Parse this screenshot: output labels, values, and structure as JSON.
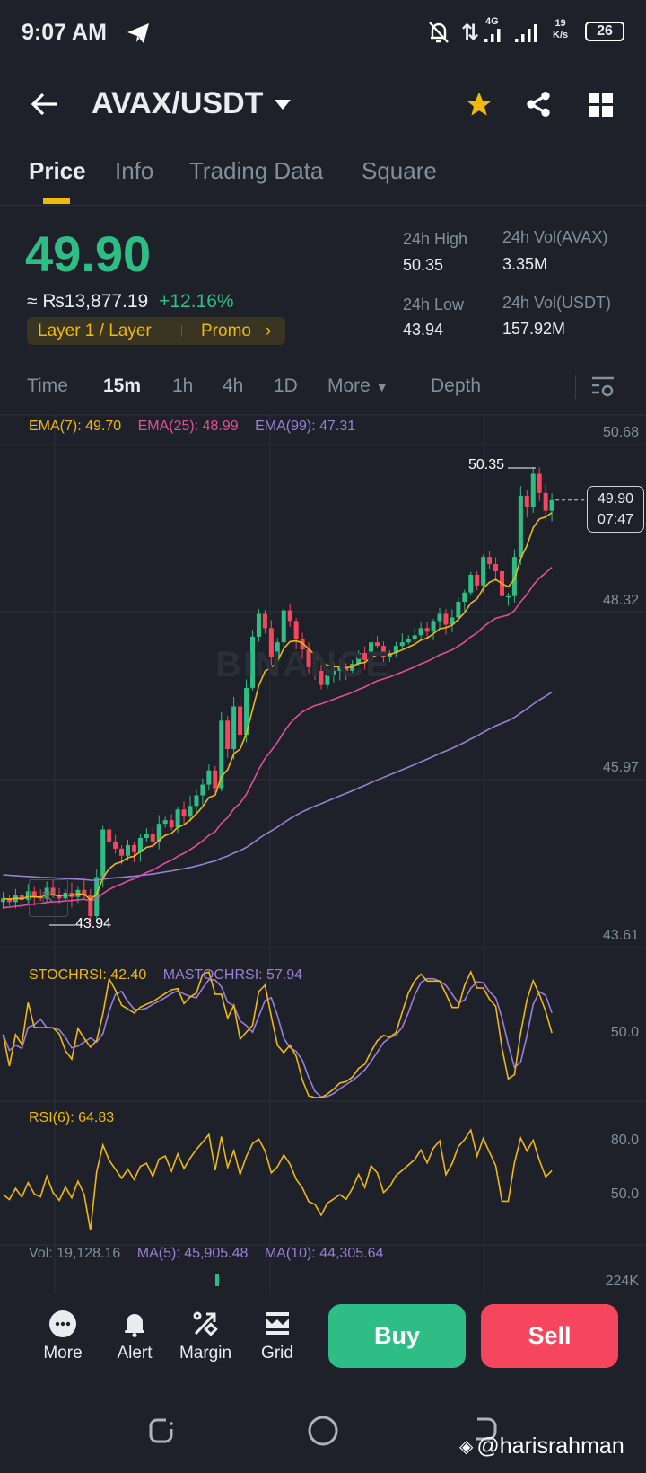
{
  "status_bar": {
    "time": "9:07 AM",
    "network": "4G",
    "speed_value": "19",
    "speed_unit": "K/s",
    "battery": "26"
  },
  "header": {
    "pair": "AVAX/USDT"
  },
  "tabs": [
    "Price",
    "Info",
    "Trading Data",
    "Square"
  ],
  "ticker": {
    "last_price": "49.90",
    "fiat_price": "≈ ₨13,877.19",
    "change": "+12.16%",
    "tag": "Layer 1 / Layer",
    "promo": "Promo",
    "high_label": "24h High",
    "high": "50.35",
    "low_label": "24h Low",
    "low": "43.94",
    "vol_base_label": "24h Vol(AVAX)",
    "vol_base": "3.35M",
    "vol_quote_label": "24h Vol(USDT)",
    "vol_quote": "157.92M"
  },
  "timeframes": {
    "time": "Time",
    "m15": "15m",
    "h1": "1h",
    "h4": "4h",
    "d1": "1D",
    "more": "More",
    "depth": "Depth"
  },
  "chart": {
    "ema7": "EMA(7): 49.70",
    "ema25": "EMA(25): 48.99",
    "ema99": "EMA(99): 47.31",
    "price_ticks": [
      "50.68",
      "48.32",
      "45.97",
      "43.61"
    ],
    "max_label": "50.35",
    "min_label": "43.94",
    "last_price": "49.90",
    "countdown": "07:47",
    "watermark": "BINANCE",
    "colors": {
      "up": "#2ebd85",
      "down": "#f6465d",
      "ema7": "#f0b90b",
      "ema25": "#e04fa0",
      "ema99": "#9b7fd4"
    },
    "closes": [
      44.3,
      44.25,
      44.35,
      44.28,
      44.4,
      44.32,
      44.3,
      44.45,
      44.35,
      44.3,
      44.38,
      44.32,
      44.42,
      44.35,
      44.05,
      44.6,
      45.27,
      45.1,
      45.0,
      44.9,
      45.05,
      44.95,
      45.15,
      45.2,
      45.1,
      45.35,
      45.4,
      45.3,
      45.55,
      45.45,
      45.6,
      45.75,
      45.9,
      46.1,
      45.85,
      46.8,
      46.4,
      47.0,
      46.6,
      47.26,
      47.98,
      48.3,
      48.1,
      47.7,
      47.9,
      48.35,
      48.2,
      47.95,
      47.8,
      47.55,
      47.5,
      47.3,
      47.45,
      47.5,
      47.55,
      47.5,
      47.6,
      47.75,
      47.65,
      47.9,
      47.85,
      47.7,
      47.75,
      47.85,
      47.9,
      47.95,
      48.0,
      48.1,
      48.05,
      48.2,
      48.3,
      48.15,
      48.25,
      48.47,
      48.6,
      48.85,
      48.7,
      49.1,
      49.0,
      48.9,
      48.55,
      48.55,
      49.1,
      49.96,
      49.8,
      50.27,
      50.0,
      49.75,
      49.9
    ],
    "stoch_label": "STOCHRSI: 42.40",
    "mastoch_label": "MASTOCHRSI: 57.94",
    "stoch_tick": "50.0",
    "rsi_label": "RSI(6): 64.83",
    "rsi_ticks": [
      "80.0",
      "50.0"
    ],
    "vol_label": "Vol: 19,128.16",
    "vol_ma5": "MA(5): 45,905.48",
    "vol_ma10": "MA(10): 44,305.64",
    "vol_tick": "224K"
  },
  "bottom_bar": {
    "more": "More",
    "alert": "Alert",
    "margin": "Margin",
    "grid": "Grid",
    "buy": "Buy",
    "sell": "Sell"
  },
  "watermark": "@harisrahman"
}
